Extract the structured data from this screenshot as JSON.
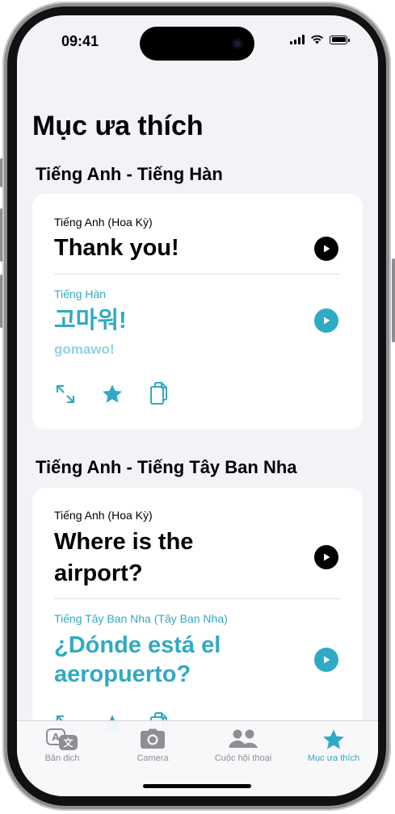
{
  "status_bar": {
    "time": "09:41"
  },
  "page": {
    "title": "Mục ưa thích"
  },
  "sections": [
    {
      "title": "Tiếng Anh - Tiếng Hàn",
      "source_lang": "Tiếng Anh (Hoa Kỳ)",
      "source_text": "Thank you!",
      "target_lang": "Tiếng Hàn",
      "target_text": "고마워!",
      "romanization": "gomawo!"
    },
    {
      "title": "Tiếng Anh - Tiếng Tây Ban Nha",
      "source_lang": "Tiếng Anh (Hoa Kỳ)",
      "source_text_line1": "Where is the",
      "source_text_line2": "airport?",
      "target_lang": "Tiếng Tây Ban Nha (Tây Ban Nha)",
      "target_text_line1": "¿Dónde está el",
      "target_text_line2": "aeropuerto?"
    }
  ],
  "tabs": [
    {
      "label": "Bản dịch",
      "icon": "translate-icon",
      "active": false
    },
    {
      "label": "Camera",
      "icon": "camera-icon",
      "active": false
    },
    {
      "label": "Cuộc hội thoại",
      "icon": "people-icon",
      "active": false
    },
    {
      "label": "Mục ưa thích",
      "icon": "star-icon",
      "active": true
    }
  ],
  "colors": {
    "accent": "#30aac4",
    "background": "#f2f2f7",
    "inactive": "#8e8e93"
  }
}
